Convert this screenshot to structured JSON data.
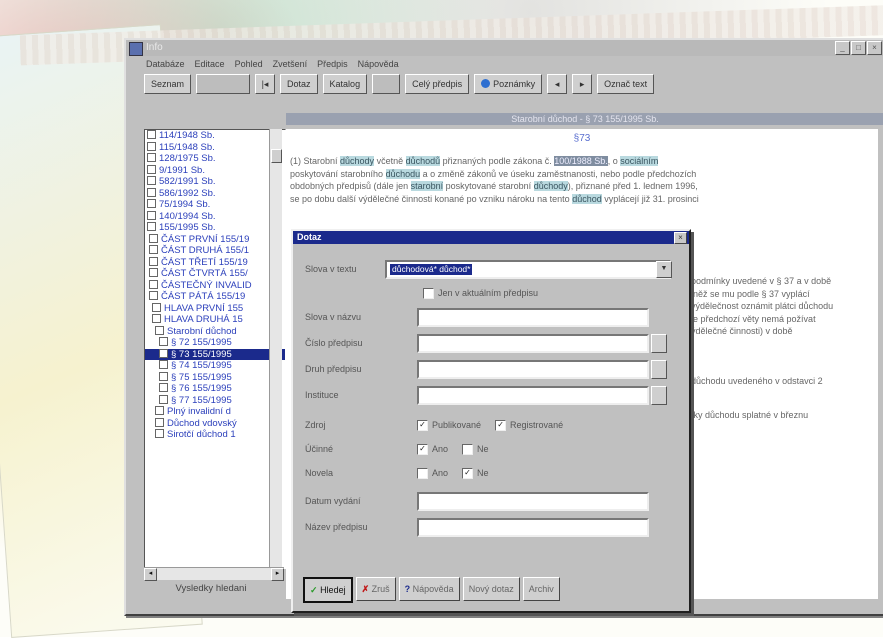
{
  "window": {
    "title": "Info"
  },
  "menu": [
    "Databáze",
    "Editace",
    "Pohled",
    "Zvetšení",
    "Předpis",
    "Nápověda"
  ],
  "toolbar": {
    "seznam": "Seznam",
    "dotaz": "Dotaz",
    "katalog": "Katalog",
    "cely_predpis": "Celý předpis",
    "poznamky": "Poznámky",
    "oznacit": "Označ text"
  },
  "doc_header": "Starobní důchod   -   § 73 155/1995 Sb.",
  "tree": [
    {
      "label": "114/1948 Sb.",
      "sel": false
    },
    {
      "label": "115/1948 Sb.",
      "sel": false
    },
    {
      "label": "128/1975 Sb.",
      "sel": false
    },
    {
      "label": "9/1991 Sb.",
      "sel": false
    },
    {
      "label": "582/1991 Sb.",
      "sel": false
    },
    {
      "label": "586/1992 Sb.",
      "sel": false
    },
    {
      "label": "75/1994 Sb.",
      "sel": false
    },
    {
      "label": "140/1994 Sb.",
      "sel": false
    },
    {
      "label": "155/1995 Sb.",
      "sel": false
    },
    {
      "label": "ČÁST PRVNÍ 155/19",
      "sel": false
    },
    {
      "label": "ČÁST DRUHÁ 155/1",
      "sel": false
    },
    {
      "label": "ČÁST TŘETÍ 155/19",
      "sel": false
    },
    {
      "label": "ČÁST ČTVRTÁ 155/",
      "sel": false
    },
    {
      "label": "ČÁSTEČNÝ INVALID",
      "sel": false
    },
    {
      "label": "ČÁST PÁTÁ 155/19",
      "sel": false
    },
    {
      "label": "HLAVA PRVNÍ 155",
      "sel": false
    },
    {
      "label": "HLAVA DRUHÁ 15",
      "sel": false
    },
    {
      "label": "Starobní důchod",
      "sel": false
    },
    {
      "label": "§ 72 155/1995",
      "sel": false
    },
    {
      "label": "§ 73 155/1995",
      "sel": true
    },
    {
      "label": "§ 74 155/1995",
      "sel": false
    },
    {
      "label": "§ 75 155/1995",
      "sel": false
    },
    {
      "label": "§ 76 155/1995",
      "sel": false
    },
    {
      "label": "§ 77 155/1995",
      "sel": false
    },
    {
      "label": "Plný invalidní d",
      "sel": false
    },
    {
      "label": "Důchod vdovský",
      "sel": false
    },
    {
      "label": "Sirotčí důchod 1",
      "sel": false
    }
  ],
  "bottom_left": "Vysledky hledani",
  "doc": {
    "section": "§73",
    "p1": [
      "(1) Starobní ",
      "důchody",
      " včetně ",
      "důchodů",
      " přiznaných podle zákona č. ",
      "100/1988 Sb.",
      ", o ",
      "sociálním",
      " zabezpečení, pokud nebyly přiznány",
      " poskytování starobního ",
      "důchodu",
      " a o změně zákonů ve úseku zaměstnanosti, nebo podle předchozích",
      " obdobných předpisů (dále jen ",
      "starobní",
      " poskytované starobní ",
      "důchody",
      "), přiznané před 1. lednem 1996,",
      " se po dobu další výdělečné činnosti konané po vzniku nároku na tento ",
      "důchod",
      " vyplácejí již 31. prosinci"
    ],
    "r1": "podmínky uvedené v § 37 a v době",
    "r2": "iněž se mu podle § 37 vyplácí",
    "r3": "výdělečnost oznámit plátci důchodu",
    "r4": "le předchozí věty nemá požívat",
    "r5": "ýdělečné činnosti) v době",
    "r6": "důchodu uvedeného v odstavci 2",
    "r7": "tky důchodu splatné v březnu"
  },
  "dialog": {
    "title": "Dotaz",
    "slova_label": "Slova v textu",
    "slova_value": "důchodová* důchod*",
    "jen_v_aktualnim": "Jen v aktuálním předpisu",
    "slova_v_nazvu": "Slova v názvu",
    "cislo_predpisu": "Číslo předpisu",
    "druh_predpisu": "Druh předpisu",
    "instituce": "Instituce",
    "zdroj": "Zdroj",
    "publikovane": "Publikované",
    "registrovane": "Registrované",
    "ucinne": "Účinné",
    "novela": "Novela",
    "ano": "Ano",
    "ne": "Ne",
    "datum_vydani": "Datum vydání",
    "nazev_predpisu": "Název předpisu",
    "buttons": {
      "hledej": "Hledej",
      "zrus": "Zruš",
      "napoveda": "Nápověda",
      "novy_dotaz": "Nový dotaz",
      "archiv": "Archiv"
    }
  },
  "colors": {
    "accent": "#1b2a8c",
    "highlight": "#b9d9df",
    "ref": "#d0202e"
  }
}
